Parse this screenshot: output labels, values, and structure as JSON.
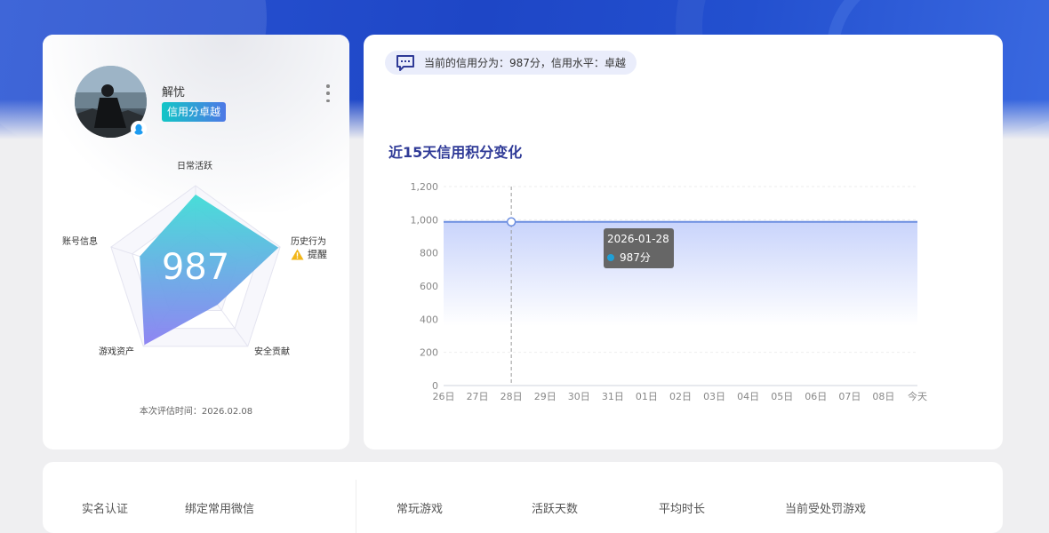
{
  "profile": {
    "username": "解忧",
    "level_tag": "信用分卓越",
    "score": "987",
    "eval_time": "本次评估时间：2026.02.08",
    "radar": {
      "labels": [
        "日常活跃",
        "历史行为",
        "安全贡献",
        "游戏资产",
        "账号信息"
      ],
      "values": [
        0.9,
        0.98,
        0.42,
        0.98,
        0.66
      ],
      "warning_text": "提醒"
    }
  },
  "main": {
    "credit_summary": "当前的信用分为：987分，信用水平：卓越",
    "chart_title": "近15天信用积分变化",
    "tooltip": {
      "date": "2026-01-28",
      "value": "987分"
    }
  },
  "chart_data": {
    "type": "area",
    "title": "近15天信用积分变化",
    "categories": [
      "26日",
      "27日",
      "28日",
      "29日",
      "30日",
      "31日",
      "01日",
      "02日",
      "03日",
      "04日",
      "05日",
      "06日",
      "07日",
      "08日",
      "今天"
    ],
    "series": [
      {
        "values": [
          987,
          987,
          987,
          987,
          987,
          987,
          987,
          987,
          987,
          987,
          987,
          987,
          987,
          987,
          987
        ]
      }
    ],
    "yticks": [
      "0",
      "200",
      "400",
      "600",
      "800",
      "1,000",
      "1,200"
    ],
    "ylim": [
      0,
      1200
    ],
    "highlight_index": 2,
    "color": "#6c8ee0"
  },
  "bottom": {
    "labels": [
      "实名认证",
      "绑定常用微信",
      "常玩游戏",
      "活跃天数",
      "平均时长",
      "当前受处罚游戏"
    ]
  }
}
